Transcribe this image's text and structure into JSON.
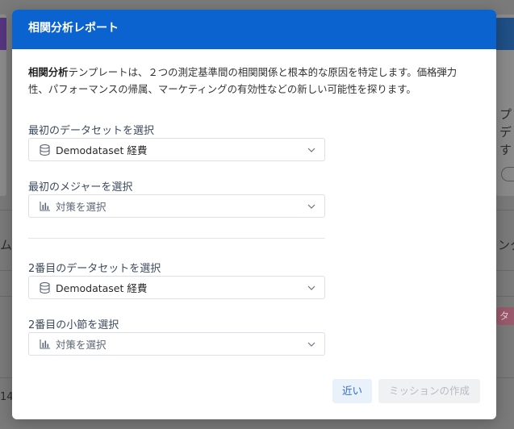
{
  "background": {
    "left_fragment_1": "ムと",
    "left_fragment_2": "14",
    "right_fragment_1": "プ",
    "right_fragment_2": "デ",
    "right_fragment_3": "す",
    "right_fragment_4": "ンタ",
    "right_pill": "タ"
  },
  "modal": {
    "title": "相関分析レポート",
    "description_bold": "相関分析",
    "description_rest_line1": "テンプレートは、２つの測定基準間の相関関係と根本的な原因を特定します。価格弾力",
    "description_line2": "性、パフォーマンスの帰属、マーケティングの有効性などの新しい可能性を探ります。",
    "fields": [
      {
        "label": "最初のデータセットを選択",
        "value": "Demodataset 経費",
        "icon": "database-icon",
        "placeholder": false
      },
      {
        "label": "最初のメジャーを選択",
        "value": "対策を選択",
        "icon": "bar-chart-icon",
        "placeholder": true
      },
      {
        "label": "2番目のデータセットを選択",
        "value": "Demodataset 経費",
        "icon": "database-icon",
        "placeholder": false
      },
      {
        "label": "2番目の小節を選択",
        "value": "対策を選択",
        "icon": "bar-chart-icon",
        "placeholder": true
      }
    ],
    "close_label": "近い",
    "create_label": "ミッションの作成"
  },
  "colors": {
    "header": "#0b63cf",
    "close_button_bg": "#e9f1fb",
    "close_button_text": "#2d6bd1",
    "disabled_button_bg": "#f0f1f3",
    "disabled_button_text": "#b6bbc3"
  }
}
